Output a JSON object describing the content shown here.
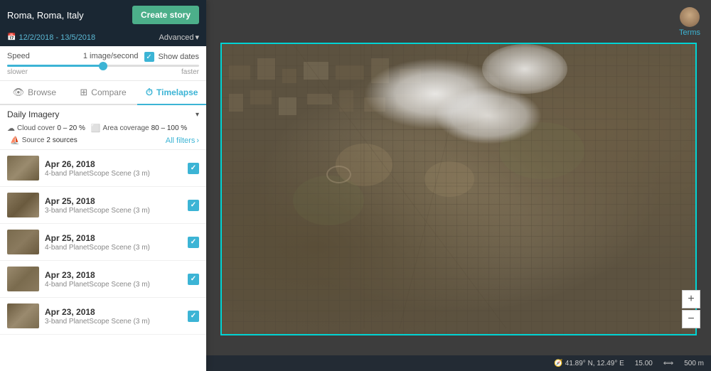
{
  "header": {
    "location": "Roma, Roma, Italy",
    "create_story_label": "Create story",
    "date_range": "12/2/2018 - 13/5/2018",
    "advanced_label": "Advanced"
  },
  "speed": {
    "label": "Speed",
    "value": "1 image/second",
    "slower_label": "slower",
    "faster_label": "faster",
    "show_dates_label": "Show dates"
  },
  "tabs": [
    {
      "id": "browse",
      "label": "Browse",
      "icon": "👁"
    },
    {
      "id": "compare",
      "label": "Compare",
      "icon": "⊞"
    },
    {
      "id": "timelapse",
      "label": "Timelapse",
      "icon": "⏱",
      "active": true
    }
  ],
  "filters": {
    "imagery_type": "Daily Imagery",
    "cloud_cover_label": "Cloud cover",
    "cloud_cover_value": "0 – 20 %",
    "area_coverage_label": "Area coverage",
    "area_coverage_value": "80 – 100 %",
    "source_label": "Source",
    "source_value": "2 sources",
    "all_filters_label": "All filters"
  },
  "image_list": [
    {
      "date": "Apr 26, 2018",
      "desc": "4-band PlanetScope Scene (3 m)",
      "checked": true
    },
    {
      "date": "Apr 25, 2018",
      "desc": "3-band PlanetScope Scene (3 m)",
      "checked": true
    },
    {
      "date": "Apr 25, 2018",
      "desc": "4-band PlanetScope Scene (3 m)",
      "checked": true
    },
    {
      "date": "Apr 23, 2018",
      "desc": "4-band PlanetScope Scene (3 m)",
      "checked": true
    },
    {
      "date": "Apr 23, 2018",
      "desc": "3-band PlanetScope Scene (3 m)",
      "checked": true
    }
  ],
  "map": {
    "coordinates": "41.89° N, 12.49° E",
    "zoom": "15.00",
    "terms_label": "Terms"
  },
  "zoom_controls": {
    "zoom_in": "+",
    "zoom_out": "−"
  }
}
